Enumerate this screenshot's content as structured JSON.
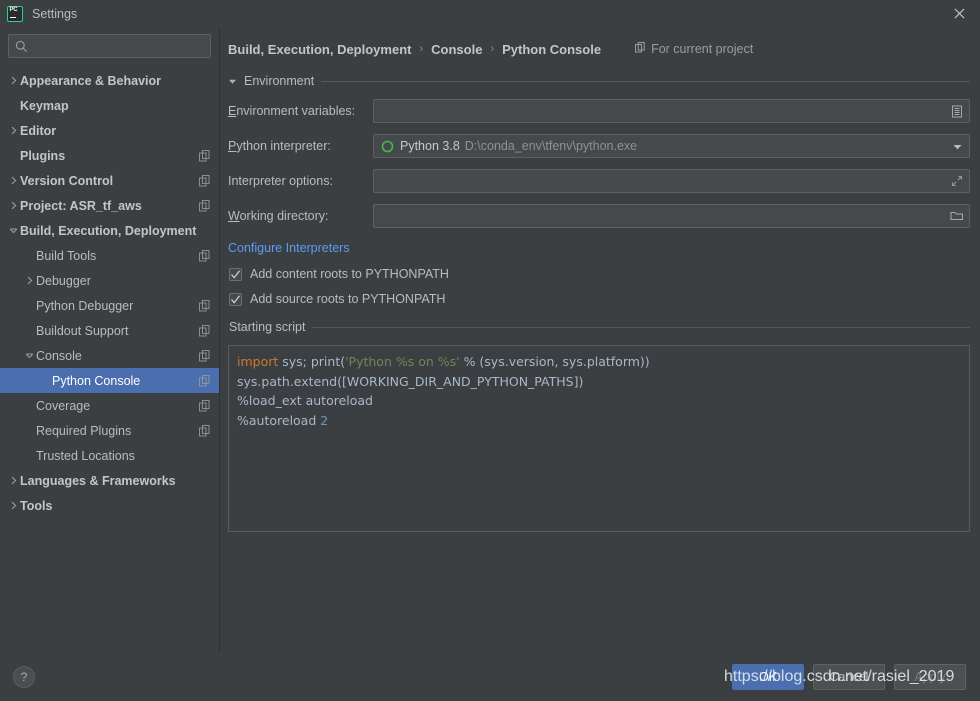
{
  "window": {
    "title": "Settings",
    "logo_text": "PC",
    "close_icon": "close-icon"
  },
  "sidebar": {
    "search": {
      "value": "",
      "placeholder": "",
      "icon": "search-icon"
    },
    "items": [
      {
        "label": "Appearance & Behavior",
        "indent": 0,
        "arrow": "collapsed",
        "bold": true,
        "copy": false,
        "selected": false
      },
      {
        "label": "Keymap",
        "indent": 0,
        "arrow": "none",
        "bold": true,
        "copy": false,
        "selected": false
      },
      {
        "label": "Editor",
        "indent": 0,
        "arrow": "collapsed",
        "bold": true,
        "copy": false,
        "selected": false
      },
      {
        "label": "Plugins",
        "indent": 0,
        "arrow": "none",
        "bold": true,
        "copy": true,
        "selected": false
      },
      {
        "label": "Version Control",
        "indent": 0,
        "arrow": "collapsed",
        "bold": true,
        "copy": true,
        "selected": false
      },
      {
        "label": "Project: ASR_tf_aws",
        "indent": 0,
        "arrow": "collapsed",
        "bold": true,
        "copy": true,
        "selected": false
      },
      {
        "label": "Build, Execution, Deployment",
        "indent": 0,
        "arrow": "expanded",
        "bold": true,
        "copy": false,
        "selected": false
      },
      {
        "label": "Build Tools",
        "indent": 1,
        "arrow": "none",
        "bold": false,
        "copy": true,
        "selected": false
      },
      {
        "label": "Debugger",
        "indent": 1,
        "arrow": "collapsed",
        "bold": false,
        "copy": false,
        "selected": false
      },
      {
        "label": "Python Debugger",
        "indent": 1,
        "arrow": "none",
        "bold": false,
        "copy": true,
        "selected": false
      },
      {
        "label": "Buildout Support",
        "indent": 1,
        "arrow": "none",
        "bold": false,
        "copy": true,
        "selected": false
      },
      {
        "label": "Console",
        "indent": 1,
        "arrow": "expanded",
        "bold": false,
        "copy": true,
        "selected": false
      },
      {
        "label": "Python Console",
        "indent": 2,
        "arrow": "none",
        "bold": false,
        "copy": true,
        "selected": true
      },
      {
        "label": "Coverage",
        "indent": 1,
        "arrow": "none",
        "bold": false,
        "copy": true,
        "selected": false
      },
      {
        "label": "Required Plugins",
        "indent": 1,
        "arrow": "none",
        "bold": false,
        "copy": true,
        "selected": false
      },
      {
        "label": "Trusted Locations",
        "indent": 1,
        "arrow": "none",
        "bold": false,
        "copy": false,
        "selected": false
      },
      {
        "label": "Languages & Frameworks",
        "indent": 0,
        "arrow": "collapsed",
        "bold": true,
        "copy": false,
        "selected": false
      },
      {
        "label": "Tools",
        "indent": 0,
        "arrow": "collapsed",
        "bold": true,
        "copy": false,
        "selected": false
      }
    ]
  },
  "header": {
    "breadcrumb": [
      "Build, Execution, Deployment",
      "Console",
      "Python Console"
    ],
    "separator": "›",
    "for_current_project": "For current project",
    "for_current_project_icon": "copy-icon"
  },
  "environment": {
    "section_title": "Environment",
    "env_vars": {
      "label_mnemonic": "E",
      "label_rest": "nvironment variables:",
      "value": "",
      "button_icon": "list-editor-icon"
    },
    "interpreter": {
      "label_mnemonic": "P",
      "label_rest": "ython interpreter:",
      "name": "Python 3.8",
      "path": "D:\\conda_env\\tfenv\\python.exe",
      "status_color": "#3fbb52",
      "button_icon": "chevron-down-icon"
    },
    "interpreter_options": {
      "label_mnemonic": "",
      "label_rest": "Interpreter options:",
      "value": "",
      "button_icon": "expand-icon"
    },
    "working_directory": {
      "label_mnemonic": "W",
      "label_rest": "orking directory:",
      "value": "",
      "button_icon": "folder-icon"
    },
    "configure_link": "Configure Interpreters",
    "checkboxes": [
      {
        "label": "Add content roots to PYTHONPATH",
        "checked": true
      },
      {
        "label": "Add source roots to PYTHONPATH",
        "checked": true
      }
    ]
  },
  "starting_script": {
    "section_title": "Starting script",
    "lines": [
      [
        {
          "t": "import",
          "c": "kw"
        },
        {
          "t": " sys; print(",
          "c": "pln"
        },
        {
          "t": "'Python %s on %s'",
          "c": "str"
        },
        {
          "t": " % (sys.version, sys.platform))",
          "c": "pln"
        }
      ],
      [
        {
          "t": "sys.path.extend([WORKING_DIR_AND_PYTHON_PATHS])",
          "c": "pln"
        }
      ],
      [
        {
          "t": "%load_ext autoreload",
          "c": "pln"
        }
      ],
      [
        {
          "t": "%autoreload ",
          "c": "pln"
        },
        {
          "t": "2",
          "c": "num"
        }
      ]
    ]
  },
  "footer": {
    "help_label": "?",
    "buttons": [
      {
        "label": "OK",
        "style": "primary"
      },
      {
        "label": "Cancel",
        "style": "normal"
      },
      {
        "label": "Apply",
        "style": "disabled"
      }
    ]
  },
  "watermark": {
    "text": "https://blog.csdn.net/rasiel_2019"
  },
  "colors": {
    "background": "#3c3f41",
    "field_background": "#45494a",
    "selection": "#4b6eaf",
    "link": "#589df6",
    "text": "#bbbbbb",
    "accent_green": "#21d789"
  }
}
